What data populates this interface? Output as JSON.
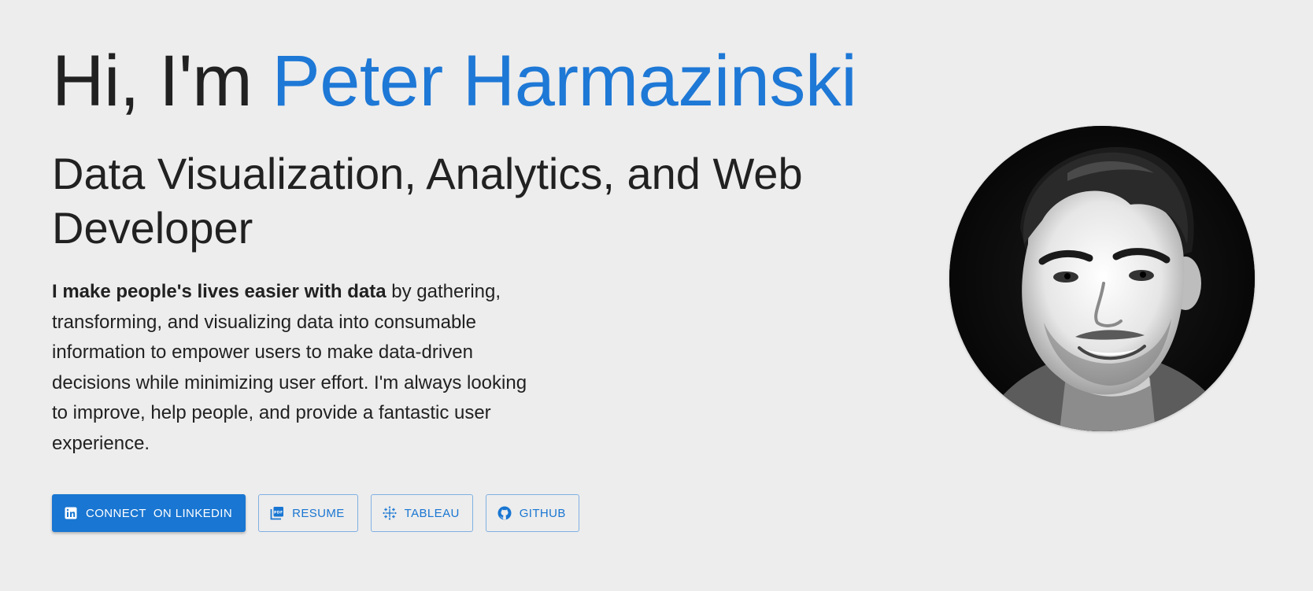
{
  "hero": {
    "greeting": "Hi, I'm ",
    "name": "Peter Harmazinski",
    "title": "Data Visualization, Analytics, and Web Developer",
    "bio_bold": "I make people's lives easier with data",
    "bio_rest": " by gathering, transforming, and visualizing data into consumable information to empower users to make data-driven decisions while minimizing user effort. I'm always looking to improve, help people, and provide a fantastic user experience."
  },
  "buttons": {
    "linkedin": {
      "label": "CONNECT  ON LINKEDIN",
      "icon": "linkedin-icon"
    },
    "resume": {
      "label": "RESUME",
      "icon": "pdf-icon"
    },
    "tableau": {
      "label": "TABLEAU",
      "icon": "tableau-icon"
    },
    "github": {
      "label": "GITHUB",
      "icon": "github-icon"
    }
  },
  "colors": {
    "background": "#ededed",
    "accent": "#1976d2",
    "text": "#212121"
  }
}
